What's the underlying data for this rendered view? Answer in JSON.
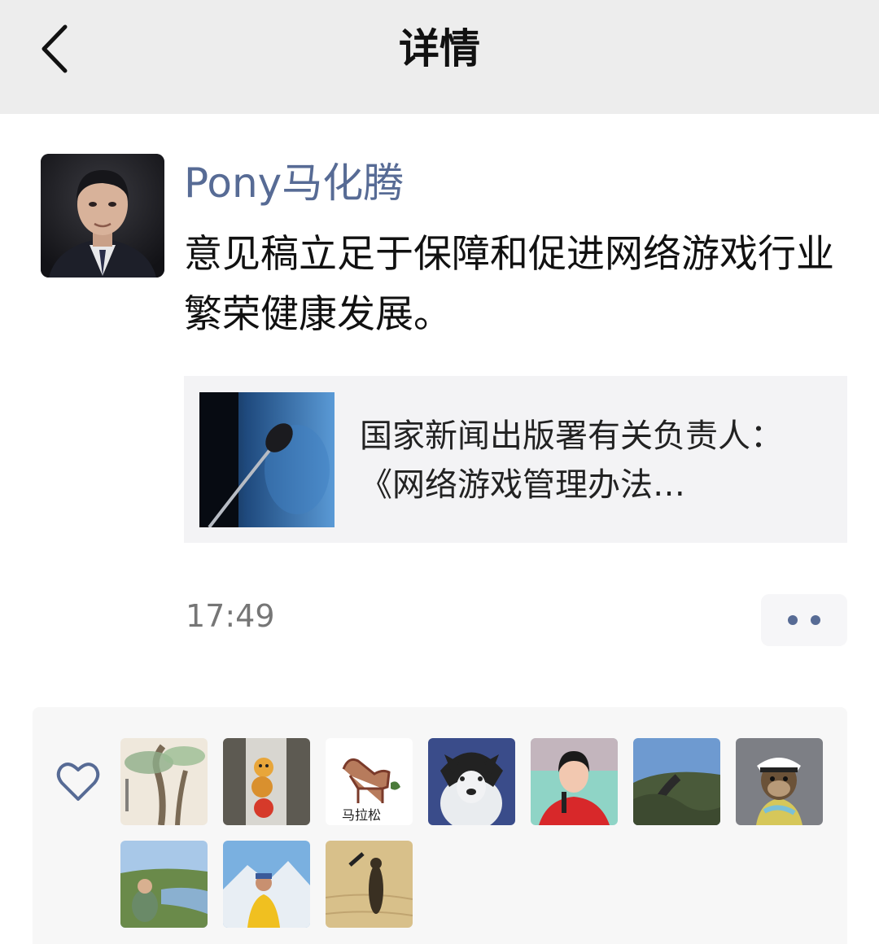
{
  "header": {
    "title": "详情",
    "back_icon": "chevron-left-icon"
  },
  "post": {
    "author": "Pony马化腾",
    "text": "意见稿立足于保障和促进网络游戏行业繁荣健康发展。",
    "link": {
      "title": "国家新闻出版署有关负责人：《网络游戏管理办法…"
    },
    "time": "17:49",
    "more_icon": "more-dots-icon"
  },
  "likes": {
    "icon": "heart-outline-icon",
    "avatar_count": 10,
    "brand_color": "#576b95",
    "text_overlay": "马拉松"
  },
  "colors": {
    "link_blue": "#576b95",
    "header_bg": "#ededed",
    "card_bg": "#f3f3f5"
  }
}
